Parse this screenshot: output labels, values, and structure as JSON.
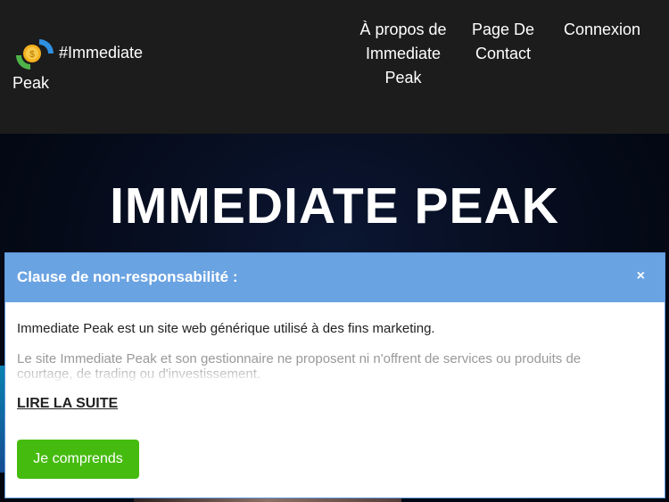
{
  "header": {
    "logo_line1": "#Immediate",
    "logo_line2": "Peak",
    "logo_icon": "coin-arrows-icon",
    "nav": {
      "about": "À propos de Immediate Peak",
      "contact": "Page De Contact",
      "login": "Connexion"
    }
  },
  "hero": {
    "title": "IMMEDIATE PEAK"
  },
  "modal": {
    "title": "Clause de non-responsabilité :",
    "close": "×",
    "text": "Immediate Peak est un site web générique utilisé à des fins marketing.",
    "text_faded": "Le site Immediate Peak et son gestionnaire ne proposent ni n'offrent de services ou produits de courtage, de trading ou d'investissement.",
    "read_more": "LIRE LA SUITE",
    "accept": "Je comprends"
  },
  "colors": {
    "header_bg": "#1c1c1c",
    "modal_header": "#6aa3e2",
    "accept_button": "#46bb0f"
  }
}
